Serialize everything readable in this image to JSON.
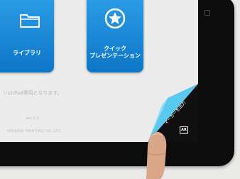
{
  "tiles": {
    "library": {
      "label": "ライブラリ",
      "icon": "folder-icon"
    },
    "quick": {
      "label_line1": "クイック",
      "label_line2": "プレゼンテーション",
      "icon": "star-icon"
    }
  },
  "footer": {
    "notice": "リはiPad専用となります。",
    "version": "ver.1.0",
    "company": "SEKIJING PRINTING CO.,LTD."
  },
  "corner_tab": {
    "label": "マーカーを出力",
    "badge": "AR"
  },
  "colors": {
    "tile_blue": "#1a88d8",
    "curl_blue": "#5bc8f0",
    "device_black": "#0c0c0d"
  }
}
